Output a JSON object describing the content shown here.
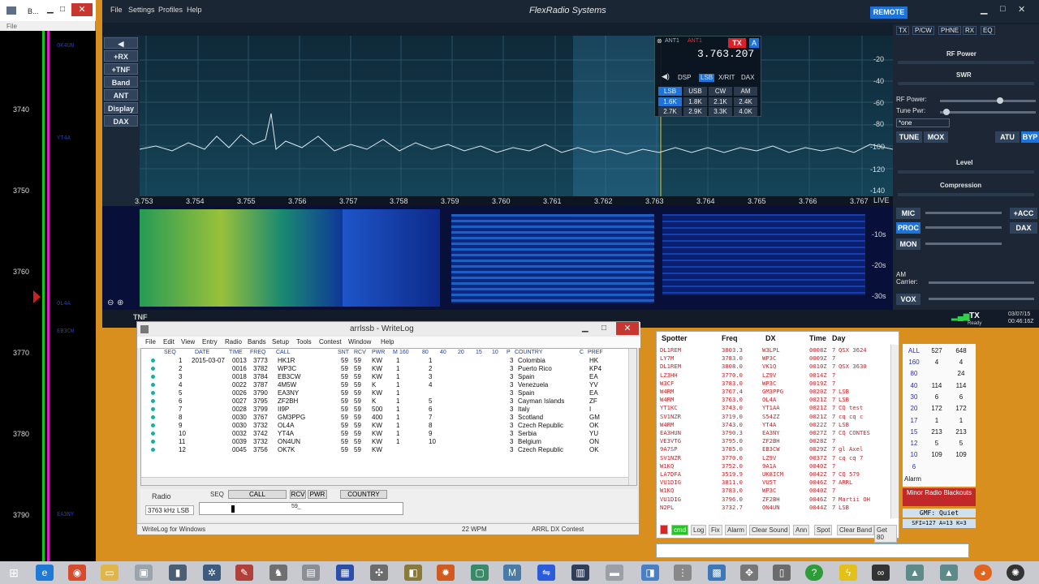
{
  "bandmap": {
    "title": "B...",
    "file_menu": "File",
    "freqs": [
      "3740",
      "3750",
      "3760",
      "3770",
      "3780",
      "3790"
    ],
    "spots": [
      "OK4UN",
      "YT4A",
      "OL4A",
      "EB3CW",
      "EA3NY"
    ]
  },
  "sdr": {
    "menu": [
      "File",
      "Settings",
      "Profiles",
      "Help"
    ],
    "brand": "FlexRadio Systems",
    "remote": "REMOTE",
    "side_buttons": [
      "+RX",
      "+TNF",
      "Band",
      "ANT",
      "Display",
      "DAX"
    ],
    "freq_ticks": [
      "3.753",
      "3.754",
      "3.755",
      "3.756",
      "3.757",
      "3.758",
      "3.759",
      "3.760",
      "3.761",
      "3.762",
      "3.763",
      "3.764",
      "3.765",
      "3.766",
      "3.767"
    ],
    "live": "LIVE",
    "db_ticks": [
      "-20",
      "-40",
      "-60",
      "-80",
      "-100",
      "-120",
      "-140"
    ],
    "wf_ticks": [
      "-10s",
      "-20s",
      "-30s"
    ],
    "tnf": "TNF",
    "slice": {
      "ant1": "ANT1",
      "ant1_rx": "ANT1",
      "frequency": "3.763.207",
      "tx": "TX",
      "letter": "A",
      "tabs": [
        "DSP",
        "LSB",
        "X/RIT",
        "DAX"
      ],
      "modes": [
        "LSB",
        "USB",
        "CW",
        "AM"
      ],
      "filters": [
        "1.6K",
        "1.8K",
        "2.1K",
        "2.4K",
        "2.7K",
        "2.9K",
        "3.3K",
        "4.0K"
      ]
    },
    "right_tabs": [
      "TX",
      "P/CW",
      "PHNE",
      "RX",
      "EQ"
    ],
    "rf_power_title": "RF Power",
    "swr": "SWR",
    "rf_power": "RF Power:",
    "tune_pwr": "Tune Pwr:",
    "profile": "*one",
    "tune": "TUNE",
    "mox": "MOX",
    "atu": "ATU",
    "byp": "BYP",
    "level": "Level",
    "compression": "Compression",
    "mic": "MIC",
    "acc": "+ACC",
    "proc": "PROC",
    "dax": "DAX",
    "mon": "MON",
    "am_carrier": "AM Carrier:",
    "vox": "VOX",
    "tx_ready": "TX",
    "ready": "Ready",
    "date": "03/07/15",
    "time": "00:46:16Z"
  },
  "writelog": {
    "title": "arrlssb - WriteLog",
    "menu": [
      "File",
      "Edit",
      "View",
      "Entry",
      "Radio",
      "Bands",
      "Setup",
      "Tools",
      "Contest",
      "Window",
      "Help"
    ],
    "headers": [
      "SEQ",
      "DATE",
      "TIME",
      "FREQ",
      "CALL",
      "SNT",
      "RCV",
      "PWR",
      "M",
      "160",
      "80",
      "40",
      "20",
      "15",
      "10",
      "P",
      "COUNTRY",
      "C",
      "PREF"
    ],
    "rows": [
      {
        "seq": "1",
        "date": "2015-03-07",
        "time": "0013",
        "freq": "3773",
        "call": "HK1R",
        "snt": "59",
        "rcv": "59",
        "pwr": "KW",
        "m": "1",
        "b80": "1",
        "p": "3",
        "country": "Colombia",
        "pref": "HK"
      },
      {
        "seq": "2",
        "date": "",
        "time": "0016",
        "freq": "3782",
        "call": "WP3C",
        "snt": "59",
        "rcv": "59",
        "pwr": "KW",
        "m": "1",
        "b80": "2",
        "p": "3",
        "country": "Puerto Rico",
        "pref": "KP4"
      },
      {
        "seq": "3",
        "date": "",
        "time": "0018",
        "freq": "3784",
        "call": "EB3CW",
        "snt": "59",
        "rcv": "59",
        "pwr": "KW",
        "m": "1",
        "b80": "3",
        "p": "3",
        "country": "Spain",
        "pref": "EA"
      },
      {
        "seq": "4",
        "date": "",
        "time": "0022",
        "freq": "3787",
        "call": "4M5W",
        "snt": "59",
        "rcv": "59",
        "pwr": "K",
        "m": "1",
        "b80": "4",
        "p": "3",
        "country": "Venezuela",
        "pref": "YV"
      },
      {
        "seq": "5",
        "date": "",
        "time": "0026",
        "freq": "3790",
        "call": "EA3NY",
        "snt": "59",
        "rcv": "59",
        "pwr": "KW",
        "m": "1",
        "b80": "",
        "p": "3",
        "country": "Spain",
        "pref": "EA"
      },
      {
        "seq": "6",
        "date": "",
        "time": "0027",
        "freq": "3795",
        "call": "ZF2BH",
        "snt": "59",
        "rcv": "59",
        "pwr": "K",
        "m": "1",
        "b80": "5",
        "p": "3",
        "country": "Cayman Islands",
        "pref": "ZF"
      },
      {
        "seq": "7",
        "date": "",
        "time": "0028",
        "freq": "3799",
        "call": "II9P",
        "snt": "59",
        "rcv": "59",
        "pwr": "500",
        "m": "1",
        "b80": "6",
        "p": "3",
        "country": "Italy",
        "pref": "I"
      },
      {
        "seq": "8",
        "date": "",
        "time": "0030",
        "freq": "3767",
        "call": "GM3PPG",
        "snt": "59",
        "rcv": "59",
        "pwr": "400",
        "m": "1",
        "b80": "7",
        "p": "3",
        "country": "Scotland",
        "pref": "GM"
      },
      {
        "seq": "9",
        "date": "",
        "time": "0030",
        "freq": "3732",
        "call": "OL4A",
        "snt": "59",
        "rcv": "59",
        "pwr": "KW",
        "m": "1",
        "b80": "8",
        "p": "3",
        "country": "Czech Republic",
        "pref": "OK"
      },
      {
        "seq": "10",
        "date": "",
        "time": "0032",
        "freq": "3742",
        "call": "YT4A",
        "snt": "59",
        "rcv": "59",
        "pwr": "KW",
        "m": "1",
        "b80": "9",
        "p": "3",
        "country": "Serbia",
        "pref": "YU"
      },
      {
        "seq": "11",
        "date": "",
        "time": "0039",
        "freq": "3732",
        "call": "ON4UN",
        "snt": "59",
        "rcv": "59",
        "pwr": "KW",
        "m": "1",
        "b80": "10",
        "p": "3",
        "country": "Belgium",
        "pref": "ON"
      },
      {
        "seq": "12",
        "date": "",
        "time": "0045",
        "freq": "3756",
        "call": "OK7K",
        "snt": "59",
        "rcv": "59",
        "pwr": "KW",
        "m": "",
        "b80": "",
        "p": "3",
        "country": "Czech Republic",
        "pref": "OK"
      }
    ],
    "radio": "Radio",
    "radio_freq": "3763 kHz LSB",
    "entry_headers": [
      "SEQ",
      "CALL",
      "RCV",
      "PWR",
      "COUNTRY"
    ],
    "entry_rcv": "59_",
    "status_left": "WriteLog for Windows",
    "status_wpm": "22 WPM",
    "status_contest": "ARRL DX Contest"
  },
  "spots": {
    "headers": [
      "Spotter",
      "Freq",
      "DX",
      "Time",
      "Day"
    ],
    "rows": [
      [
        "DL1REM",
        "3803.3",
        "W3LPL",
        "0008Z",
        "7",
        "QSX 3624"
      ],
      [
        "LY7M",
        "3783.0",
        "WP3C",
        "0009Z",
        "7",
        ""
      ],
      [
        "DL1REM",
        "3808.0",
        "VK1Q",
        "0010Z",
        "7",
        "QSX 3630"
      ],
      [
        "LZ3HH",
        "3770.0",
        "LZ9V",
        "0014Z",
        "7",
        ""
      ],
      [
        "W3CF",
        "3783.0",
        "WP3C",
        "0019Z",
        "7",
        ""
      ],
      [
        "W4RM",
        "3767.4",
        "GM3PPG",
        "0020Z",
        "7",
        "LSB"
      ],
      [
        "W4RM",
        "3763.0",
        "OL4A",
        "0021Z",
        "7",
        "LSB"
      ],
      [
        "YT1KC",
        "3743.0",
        "YT1AA",
        "0021Z",
        "7",
        "CQ test"
      ],
      [
        "SV1NZR",
        "3719.0",
        "S54ZZ",
        "0021Z",
        "7",
        "cq cq c"
      ],
      [
        "W4RM",
        "3743.0",
        "YT4A",
        "0022Z",
        "7",
        "LSB"
      ],
      [
        "EA3HUN",
        "3790.3",
        "EA3NY",
        "0027Z",
        "7",
        "CQ CONTES"
      ],
      [
        "VE3VTG",
        "3795.0",
        "ZF2BH",
        "0028Z",
        "7",
        ""
      ],
      [
        "9A7SP",
        "3785.0",
        "EB3CW",
        "0029Z",
        "7",
        "gl Axel"
      ],
      [
        "SV1NZR",
        "3770.0",
        "LZ9V",
        "0037Z",
        "7",
        "cq cq 7"
      ],
      [
        "W1KQ",
        "3752.0",
        "9A1A",
        "0040Z",
        "7",
        ""
      ],
      [
        "LA7DFA",
        "3519.9",
        "UK8ICM",
        "0042Z",
        "7",
        "CQ 579"
      ],
      [
        "VU1DIG",
        "3811.0",
        "VU5T",
        "0046Z",
        "7",
        "ARRL"
      ],
      [
        "W1KQ",
        "3783.0",
        "WP3C",
        "0040Z",
        "7",
        ""
      ],
      [
        "VU1DIG",
        "3796.0",
        "ZF2BH",
        "0046Z",
        "7",
        "Martii OH"
      ],
      [
        "N2PL",
        "3732.7",
        "ON4UN",
        "0044Z",
        "7",
        "LSB"
      ]
    ],
    "tools": [
      "Log",
      "Fix",
      "Alarm",
      "Clear Sound",
      "Ann",
      "Spot",
      "Clear Band",
      "Get 80"
    ],
    "cmd_label": "cmd"
  },
  "counts": {
    "head": [
      "ALL",
      "527",
      "648"
    ],
    "rows": [
      [
        "160",
        "4",
        "4"
      ],
      [
        "80",
        "",
        "24"
      ],
      [
        "40",
        "114",
        "114"
      ],
      [
        "30",
        "6",
        "6"
      ],
      [
        "20",
        "172",
        "172"
      ],
      [
        "17",
        "1",
        "1"
      ],
      [
        "15",
        "213",
        "213"
      ],
      [
        "12",
        "5",
        "5"
      ],
      [
        "10",
        "109",
        "109"
      ],
      [
        "6",
        "",
        ""
      ]
    ],
    "alarm": "Alarm",
    "blackouts": "Minor Radio Blackouts",
    "gmf": "GMF: Quiet",
    "sfi": "SFI=127 A=13 K=3"
  },
  "colors": {
    "accent": "#1e73d8",
    "tx_red": "#d8232a",
    "spot_red": "#c1262b"
  }
}
